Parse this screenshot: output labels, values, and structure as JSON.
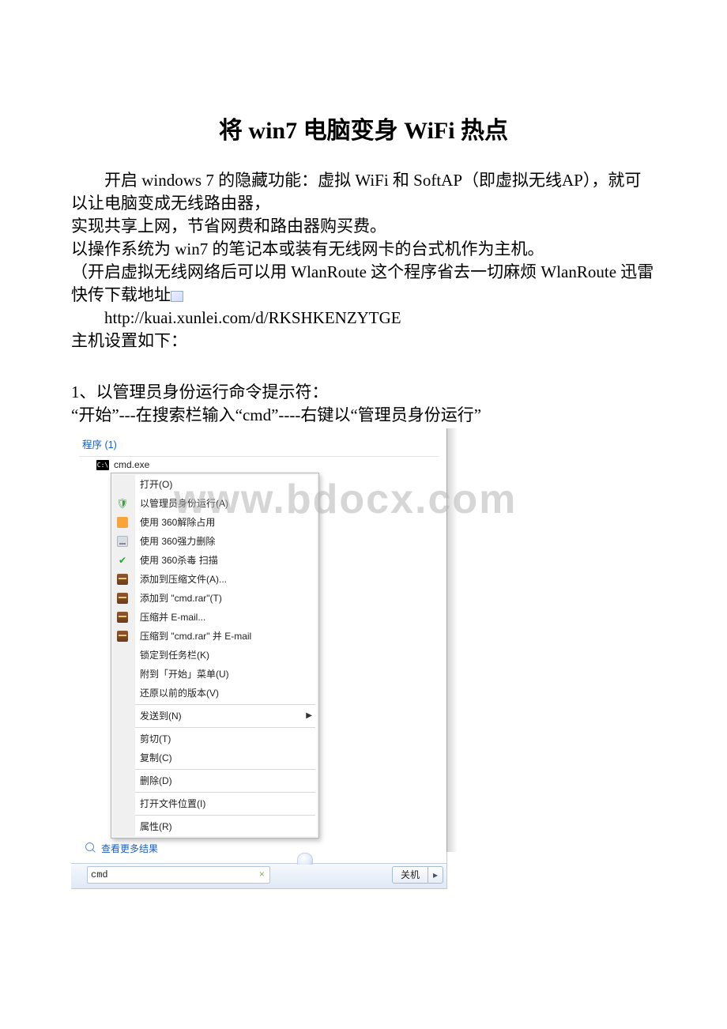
{
  "title": "将 win7 电脑变身 WiFi 热点",
  "para": {
    "p1": "开启 windows 7 的隐藏功能：虚拟 WiFi 和 SoftAP（即虚拟无线AP），就可以让电脑变成无线路由器，",
    "p2": "实现共享上网，节省网费和路由器购买费。",
    "p3": "以操作系统为 win7 的笔记本或装有无线网卡的台式机作为主机。",
    "p4a": "（开启虚拟无线网络后可以用 WlanRoute 这个程序省去一切麻烦",
    "p4b": " WlanRoute 迅雷快传下载地址",
    "p5": "http://kuai.xunlei.com/d/RKSHKENZYTGE",
    "p6": "主机设置如下：",
    "p7": "1、以管理员身份运行命令提示符：",
    "p8": "“开始”---在搜索栏输入“cmd”----右键以“管理员身份运行”"
  },
  "watermark": "www.bdocx.com",
  "startmenu": {
    "resultsHeader": "程序 (1)",
    "cmdexe": "cmd.exe",
    "seeMore": "查看更多结果",
    "searchValue": "cmd",
    "shutdown": "关机",
    "shutdownArrow": "▸",
    "menu": {
      "open": "打开(O)",
      "runas": "以管理员身份运行(A)",
      "unlock360": "使用 360解除占用",
      "forcedel360": "使用 360强力删除",
      "scan360": "使用 360杀毒 扫描",
      "addarchive": "添加到压缩文件(A)...",
      "addcmdrar": "添加到 \"cmd.rar\"(T)",
      "zipemail": "压缩并 E-mail...",
      "zipcmdemail": "压缩到 \"cmd.rar\" 并 E-mail",
      "pin": "锁定到任务栏(K)",
      "pinstart": "附到「开始」菜单(U)",
      "restore": "还原以前的版本(V)",
      "sendto": "发送到(N)",
      "cut": "剪切(T)",
      "copy": "复制(C)",
      "delete": "删除(D)",
      "openloc": "打开文件位置(I)",
      "props": "属性(R)"
    }
  }
}
